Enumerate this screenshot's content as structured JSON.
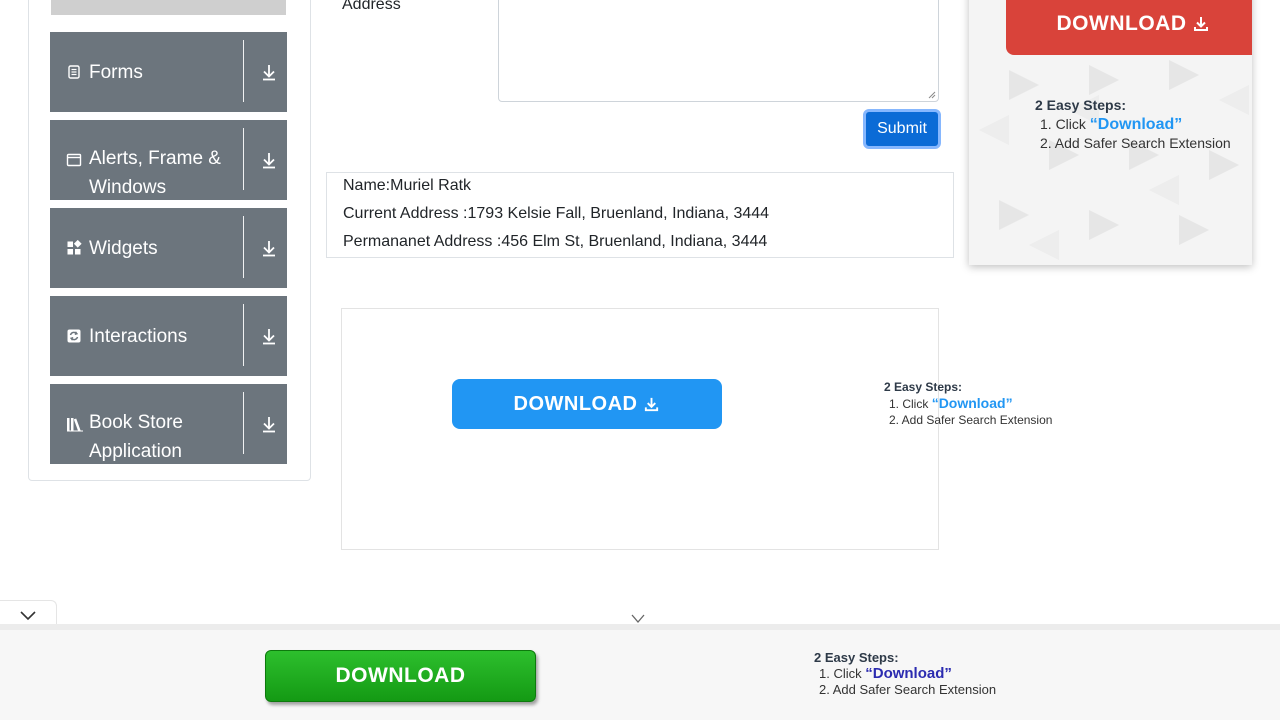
{
  "sidebar": {
    "groups": [
      {
        "label": "Forms",
        "icon": "form-icon"
      },
      {
        "label": "Alerts, Frame & Windows",
        "icon": "window-icon"
      },
      {
        "label": "Widgets",
        "icon": "widgets-icon"
      },
      {
        "label": "Interactions",
        "icon": "interactions-icon"
      },
      {
        "label": "Book Store Application",
        "icon": "books-icon"
      }
    ]
  },
  "form": {
    "address_label": "Address",
    "address_value": "",
    "submit_label": "Submit"
  },
  "output": {
    "name": "Name:Muriel Ratk",
    "current_address": "Current Address :1793 Kelsie Fall, Bruenland, Indiana, 3444",
    "permanent_address": "Permananet Address :456 Elm St, Bruenland, Indiana, 3444"
  },
  "ads": {
    "download_label": "DOWNLOAD",
    "steps_title": "2 Easy Steps:",
    "step1_prefix": "1. Click ",
    "step1_link": "“Download”",
    "step2": "2. Add Safer Search Extension"
  },
  "colors": {
    "sidebar_group": "#6c757d",
    "submit": "#0b6bd6",
    "ad_red": "#d9433a",
    "ad_blue": "#2196f3",
    "ad_green": "#149a14",
    "steps_link": "#2196f3",
    "steps_link_dark": "#2b2bb0"
  }
}
